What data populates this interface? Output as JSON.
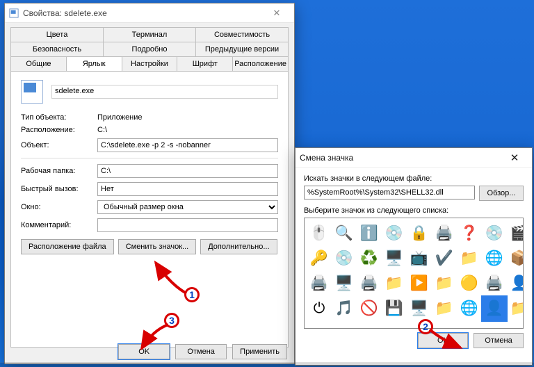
{
  "props": {
    "title": "Свойства: sdelete.exe",
    "tabs_row1": [
      "Цвета",
      "Терминал",
      "Совместимость"
    ],
    "tabs_row1b": [
      "Безопасность",
      "Подробно",
      "Предыдущие версии"
    ],
    "tabs_row2": [
      "Общие",
      "Ярлык",
      "Настройки",
      "Шрифт",
      "Расположение"
    ],
    "active_tab": "Ярлык",
    "file_name": "sdelete.exe",
    "rows": {
      "type_label": "Тип объекта:",
      "type_value": "Приложение",
      "loc_label": "Расположение:",
      "loc_value": "C:\\",
      "target_label": "Объект:",
      "target_value": "C:\\sdelete.exe -p 2 -s -nobanner",
      "startin_label": "Рабочая папка:",
      "startin_value": "C:\\",
      "hotkey_label": "Быстрый вызов:",
      "hotkey_value": "Нет",
      "window_label": "Окно:",
      "window_value": "Обычный размер окна",
      "comment_label": "Комментарий:",
      "comment_value": ""
    },
    "btns": {
      "open_loc": "Расположение файла",
      "change_icon": "Сменить значок...",
      "advanced": "Дополнительно..."
    },
    "ok": "OK",
    "cancel": "Отмена",
    "apply": "Применить"
  },
  "change_icon": {
    "title": "Смена значка",
    "label_path": "Искать значки в следующем файле:",
    "path_value": "%SystemRoot%\\System32\\SHELL32.dll",
    "browse": "Обзор...",
    "label_list": "Выберите значок из следующего списка:",
    "ok": "OK",
    "cancel": "Отмена",
    "selected_index": 31
  },
  "annotations": {
    "n1": "1",
    "n2": "2",
    "n3": "3"
  }
}
